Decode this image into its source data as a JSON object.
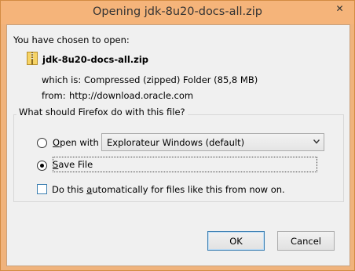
{
  "window": {
    "title": "Opening jdk-8u20-docs-all.zip",
    "close_glyph": "✕"
  },
  "dialog": {
    "intro": "You have chosen to open:",
    "file_name": "jdk-8u20-docs-all.zip",
    "which_is_label": "which is:",
    "which_is_value": "Compressed (zipped) Folder (85,8 MB)",
    "from_label": "from:",
    "from_value": "http://download.oracle.com",
    "group_title": "What should Firefox do with this file?",
    "open_with": {
      "label_prefix": "",
      "label_accel": "O",
      "label_rest": "pen with",
      "selected": false,
      "app": "Explorateur Windows (default)"
    },
    "save_file": {
      "label_accel": "S",
      "label_rest": "ave File",
      "selected": true
    },
    "auto": {
      "label_before": "Do this ",
      "label_accel": "a",
      "label_after": "utomatically for files like this from now on.",
      "checked": false
    },
    "ok_label": "OK",
    "cancel_label": "Cancel"
  },
  "colors": {
    "frame": "#f5b47a",
    "client": "#f0f0f0",
    "accent": "#3c7fb1"
  },
  "icons": {
    "file": "zip-folder-icon",
    "dropdown": "chevron-down-icon",
    "close": "close-icon"
  }
}
